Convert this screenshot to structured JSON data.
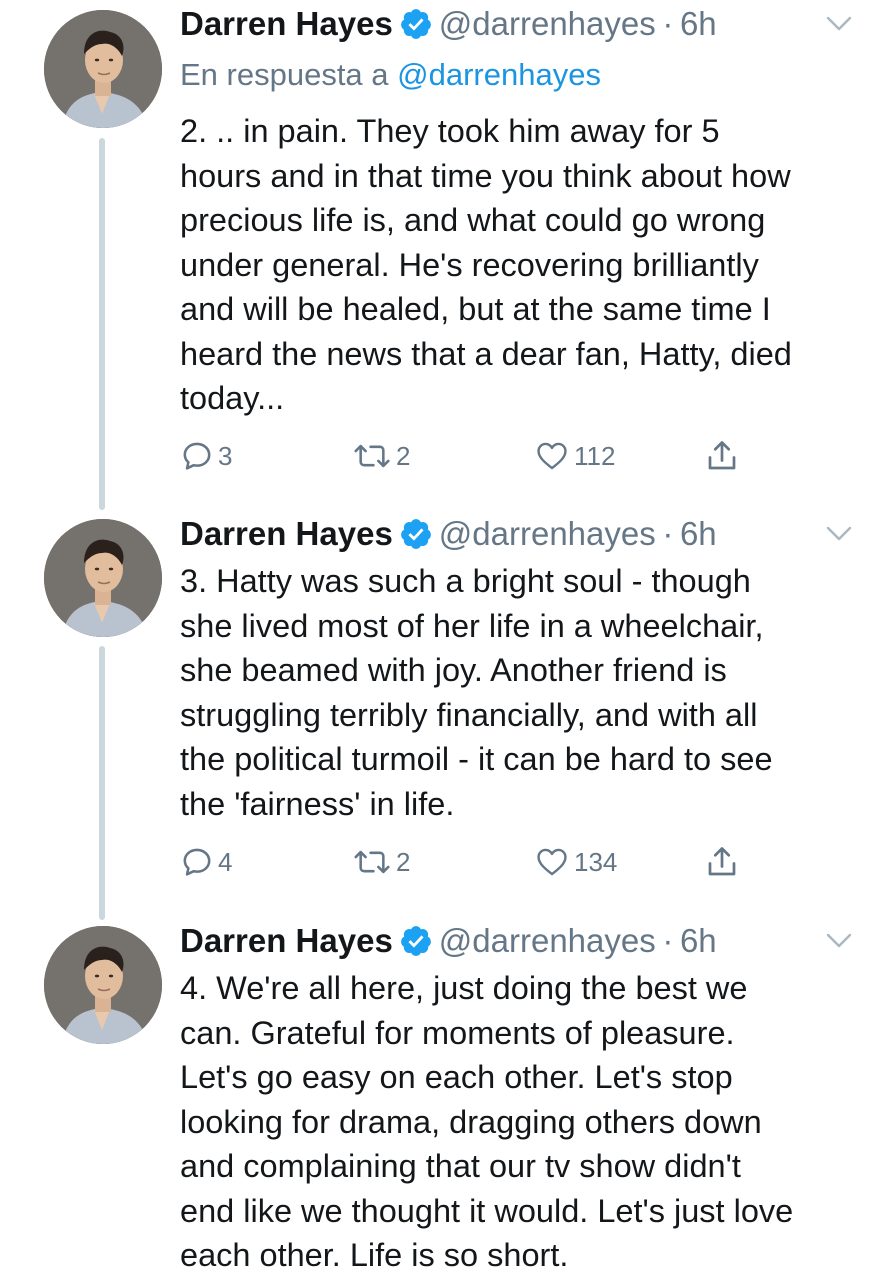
{
  "colors": {
    "accent": "#1da1f2",
    "mention": "#1b95e0",
    "secondary_text": "#657786",
    "thread_line": "#ccd6dd"
  },
  "tweets": [
    {
      "author": {
        "name": "Darren Hayes",
        "handle": "@darrenhayes",
        "verified": true
      },
      "separator": "·",
      "time": "6h",
      "reply_to": {
        "prefix": "En respuesta a",
        "mention": "@darrenhayes"
      },
      "text": "2. .. in pain.  They took him away for 5\nhours and in that time you think about how\nprecious life is, and what could go wrong\nunder general. He's recovering brilliantly\nand will be healed, but at the same time I\nheard the news that a dear fan, Hatty, died\ntoday...",
      "counts": {
        "replies": "3",
        "retweets": "2",
        "likes": "112"
      }
    },
    {
      "author": {
        "name": "Darren Hayes",
        "handle": "@darrenhayes",
        "verified": true
      },
      "separator": "·",
      "time": "6h",
      "text": "3. Hatty was such a bright soul - though\nshe lived most of her life in a wheelchair,\nshe beamed with joy.  Another friend is\nstruggling terribly financially, and with all\nthe political turmoil - it can be hard to see\nthe 'fairness' in life.",
      "counts": {
        "replies": "4",
        "retweets": "2",
        "likes": "134"
      }
    },
    {
      "author": {
        "name": "Darren Hayes",
        "handle": "@darrenhayes",
        "verified": true
      },
      "separator": "·",
      "time": "6h",
      "text": "4. We're all here, just doing the best we\ncan.  Grateful for moments of pleasure.\nLet's go easy on each other.  Let's stop\nlooking for drama, dragging others down\nand complaining that our tv show didn't\nend like we thought it would. Let's just love\neach other.  Life is so short."
    }
  ]
}
